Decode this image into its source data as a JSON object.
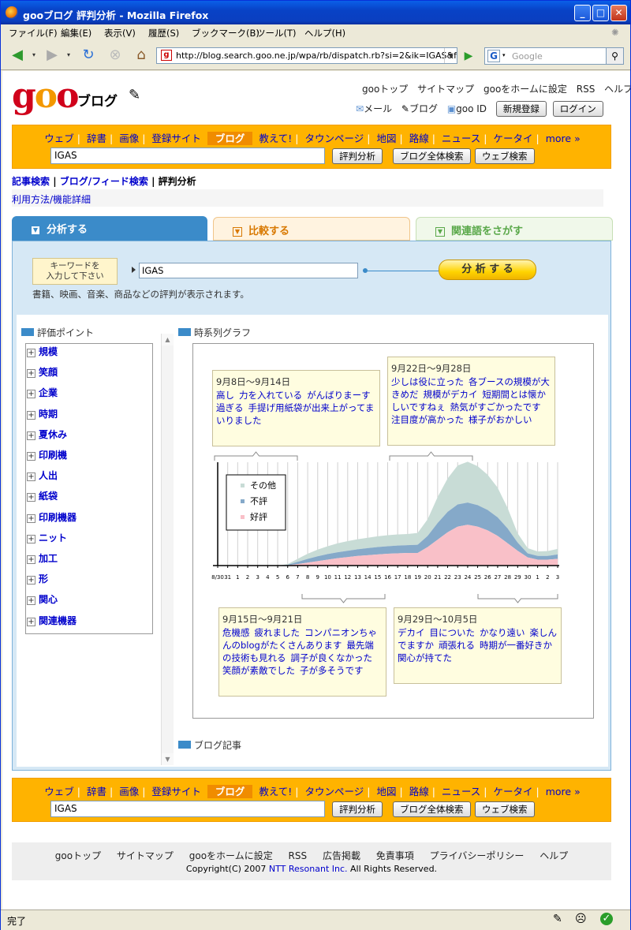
{
  "window": {
    "title": "gooブログ 評判分析 - Mozilla Firefox"
  },
  "menu": [
    "ファイル(F)",
    "編集(E)",
    "表示(V)",
    "履歴(S)",
    "ブックマーク(B)",
    "ツール(T)",
    "ヘルプ(H)"
  ],
  "nav": {
    "url": "http://blog.search.goo.ne.jp/wpa/rb/dispatch.rb?si=2&ik=IGAS&fro",
    "search_placeholder": "Google"
  },
  "header": {
    "logo": "goo",
    "service": "ブログ",
    "links": [
      "gooトップ",
      "サイトマップ",
      "gooをホームに設定",
      "RSS",
      "ヘルプ"
    ],
    "mail": "メール",
    "blog": "ブログ",
    "gooid": "goo ID",
    "register": "新規登録",
    "login": "ログイン"
  },
  "searchbar": {
    "tabs": [
      "ウェブ",
      "辞書",
      "画像",
      "登録サイト",
      "ブログ",
      "教えて!",
      "タウンページ",
      "地図",
      "路線",
      "ニュース",
      "ケータイ",
      "more »"
    ],
    "active": "ブログ",
    "query": "IGAS",
    "btn_reputation": "評判分析",
    "btn_blog": "ブログ全体検索",
    "btn_web": "ウェブ検索"
  },
  "breadcrumb": {
    "item1": "記事検索",
    "item2": "ブログ/フィード検索",
    "current": "評判分析"
  },
  "usage_link": "利用方法/機能詳細",
  "tabs": {
    "analyze": "分析する",
    "compare": "比較する",
    "related": "関連語をさがす"
  },
  "analyze": {
    "keyword_label_line1": "キーワードを",
    "keyword_label_line2": "入力して下さい",
    "keyword": "IGAS",
    "button": "分 析 す る",
    "description": "書籍、映画、音楽、商品などの評判が表示されます。"
  },
  "evaluation": {
    "title": "評価ポイント",
    "items": [
      "規模",
      "笑顔",
      "企業",
      "時期",
      "夏休み",
      "印刷機",
      "人出",
      "紙袋",
      "印刷機器",
      "ニット",
      "加工",
      "形",
      "関心",
      "関連機器"
    ]
  },
  "timeline": {
    "title": "時系列グラフ",
    "bubbles": [
      {
        "period": "9月8日～9月14日",
        "words": [
          "高し",
          "力を入れている",
          "がんばりまーす",
          "過ぎる",
          "手提げ用紙袋が出来上がってまいりました"
        ]
      },
      {
        "period": "9月22日～9月28日",
        "words": [
          "少しは役に立った",
          "各ブースの規模が大きめだ",
          "規模がデカイ",
          "短期間とは懐かしいですねぇ",
          "熱気がすごかったです",
          "注目度が高かった",
          "様子がおかしい"
        ]
      },
      {
        "period": "9月15日～9月21日",
        "words": [
          "危機感",
          "疲れました",
          "コンパニオンちゃんのblogがたくさんあります",
          "最先端の技術も見れる",
          "調子が良くなかった",
          "笑顔が素敵でした",
          "子が多そうです"
        ]
      },
      {
        "period": "9月29日～10月5日",
        "words": [
          "デカイ",
          "目についた",
          "かなり遠い",
          "楽しんでますか",
          "頑張れる",
          "時期が一番好きか",
          "関心が持てた"
        ]
      }
    ]
  },
  "blog_articles": {
    "title": "ブログ記事"
  },
  "chart_data": {
    "type": "area",
    "x": [
      "8/30",
      "31",
      "1",
      "2",
      "3",
      "4",
      "5",
      "6",
      "7",
      "8",
      "9",
      "10",
      "11",
      "12",
      "13",
      "14",
      "15",
      "16",
      "17",
      "18",
      "19",
      "20",
      "21",
      "22",
      "23",
      "24",
      "25",
      "26",
      "27",
      "28",
      "29",
      "30",
      "1",
      "2",
      "3"
    ],
    "series": [
      {
        "name": "好評",
        "color": "#f9c0c8",
        "values": [
          0,
          0,
          0,
          0,
          0,
          0,
          0,
          0.1,
          0.4,
          0.8,
          1.2,
          1.6,
          2,
          2.3,
          2.6,
          2.8,
          3,
          3.2,
          3.3,
          3.4,
          3.4,
          5,
          7,
          9,
          10.5,
          11,
          10.5,
          9.5,
          8,
          6,
          4,
          2.2,
          1.6,
          1.6,
          1.8
        ]
      },
      {
        "name": "不評",
        "color": "#85a9c9",
        "values": [
          0,
          0,
          0,
          0,
          0,
          0,
          0,
          0.1,
          0.6,
          1.0,
          1.3,
          1.5,
          1.6,
          1.7,
          1.8,
          1.9,
          2,
          2,
          2.1,
          2.1,
          2.2,
          3,
          4.5,
          5.5,
          6,
          6,
          5.8,
          5.5,
          5,
          4,
          2.2,
          1.1,
          1,
          1,
          1.2
        ]
      },
      {
        "name": "その他",
        "color": "#c8dcd6",
        "values": [
          0,
          0,
          0,
          0,
          0,
          0,
          0,
          0.2,
          0.8,
          1.4,
          1.8,
          2.1,
          2.4,
          2.6,
          2.7,
          2.8,
          2.9,
          3,
          3,
          3,
          3.2,
          4.5,
          7,
          9,
          10.5,
          11,
          10.5,
          9.5,
          8,
          5.5,
          2.5,
          1.4,
          1.2,
          1.3,
          1.5
        ]
      }
    ],
    "legend": "top-left"
  },
  "footer": {
    "links": [
      "gooトップ",
      "サイトマップ",
      "gooをホームに設定",
      "RSS",
      "広告掲載",
      "免責事項",
      "プライバシーポリシー",
      "ヘルプ"
    ],
    "copyright_prefix": "Copyright(C) 2007 ",
    "company": "NTT Resonant Inc.",
    "copyright_suffix": " All Rights Reserved."
  },
  "status": {
    "text": "完了"
  }
}
